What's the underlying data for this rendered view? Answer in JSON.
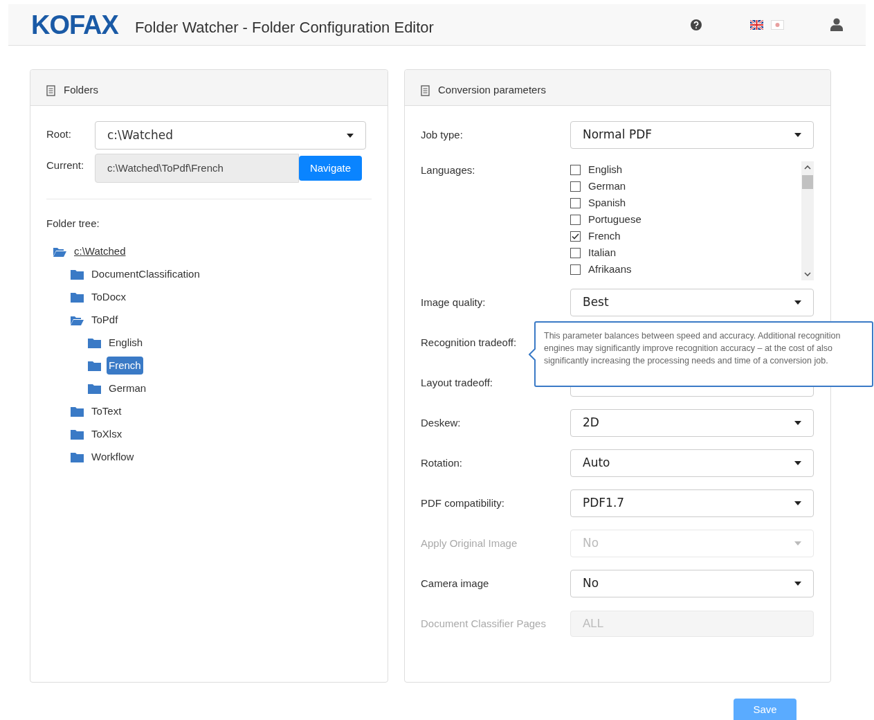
{
  "header": {
    "logo": "KOFAX",
    "title": "Folder Watcher - Folder Configuration Editor"
  },
  "folders": {
    "title": "Folders",
    "root_label": "Root:",
    "root_value": "c:\\Watched",
    "current_label": "Current:",
    "current_value": "c:\\Watched\\ToPdf\\French",
    "navigate": "Navigate",
    "tree_label": "Folder tree:",
    "tree": [
      {
        "label": "c:\\Watched",
        "expanded": true,
        "selected": false,
        "link": true,
        "children": [
          {
            "label": "DocumentClassification",
            "expanded": false,
            "selected": false
          },
          {
            "label": "ToDocx",
            "expanded": false,
            "selected": false
          },
          {
            "label": "ToPdf",
            "expanded": true,
            "selected": false,
            "children": [
              {
                "label": "English",
                "expanded": false,
                "selected": false
              },
              {
                "label": "French",
                "expanded": false,
                "selected": true
              },
              {
                "label": "German",
                "expanded": false,
                "selected": false
              }
            ]
          },
          {
            "label": "ToText",
            "expanded": false,
            "selected": false
          },
          {
            "label": "ToXlsx",
            "expanded": false,
            "selected": false
          },
          {
            "label": "Workflow",
            "expanded": false,
            "selected": false
          }
        ]
      }
    ]
  },
  "conversion": {
    "title": "Conversion parameters",
    "rows": [
      {
        "kind": "select",
        "label": "Job type:",
        "value": "Normal PDF",
        "disabled": false
      },
      {
        "kind": "languages",
        "label": "Languages:",
        "options": [
          {
            "label": "English",
            "checked": false
          },
          {
            "label": "German",
            "checked": false
          },
          {
            "label": "Spanish",
            "checked": false
          },
          {
            "label": "Portuguese",
            "checked": false
          },
          {
            "label": "French",
            "checked": true
          },
          {
            "label": "Italian",
            "checked": false
          },
          {
            "label": "Afrikaans",
            "checked": false
          }
        ]
      },
      {
        "kind": "select",
        "label": "Image quality:",
        "value": "Best",
        "disabled": false
      },
      {
        "kind": "label",
        "label": "Recognition tradeoff:",
        "disabled": false
      },
      {
        "kind": "select",
        "label": "Layout tradeoff:",
        "disabled": false
      },
      {
        "kind": "select",
        "label": "Deskew:",
        "value": "2D",
        "disabled": false
      },
      {
        "kind": "select",
        "label": "Rotation:",
        "value": "Auto",
        "disabled": false
      },
      {
        "kind": "select",
        "label": "PDF compatibility:",
        "value": "PDF1.7",
        "disabled": false
      },
      {
        "kind": "select",
        "label": "Apply Original Image",
        "value": "No",
        "disabled": true
      },
      {
        "kind": "select",
        "label": "Camera image",
        "value": "No",
        "disabled": false
      },
      {
        "kind": "input",
        "label": "Document Classifier Pages",
        "value": "ALL",
        "disabled": true
      }
    ],
    "tooltip": "This parameter balances between speed and accuracy. Additional recognition engines may significantly improve recognition accuracy – at the cost of also significantly increasing the processing needs and time of a conversion job."
  },
  "save": "Save"
}
